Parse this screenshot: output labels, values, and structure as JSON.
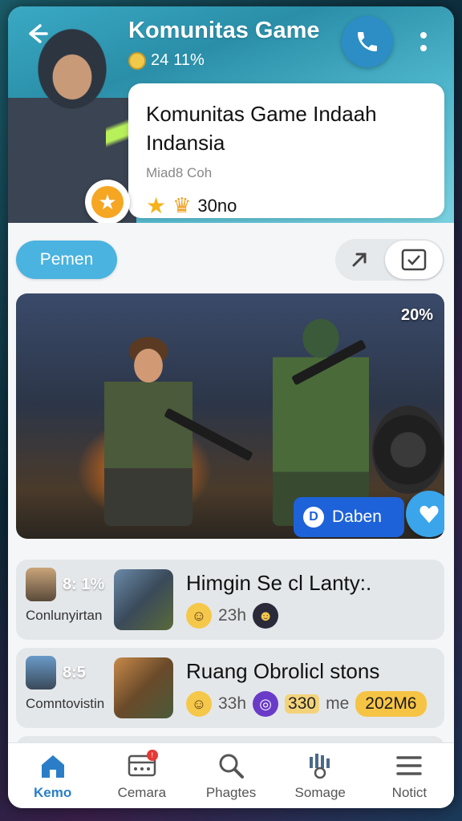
{
  "header": {
    "title": "Komunitas Game",
    "meta_count": "24",
    "meta_percent": "11%"
  },
  "info_card": {
    "name": "Komunitas Game Indaah Indansia",
    "subtitle": "Miad8 Coh",
    "rating": "30no"
  },
  "actions": {
    "pill_label": "Pemen"
  },
  "media": {
    "percent": "20%",
    "chip_label": "Daben"
  },
  "list": [
    {
      "pct": "8: 1%",
      "label": "Conlunyirtan",
      "title": "Himgin Se cl Lanty:.",
      "time": "23h"
    },
    {
      "pct": "8:5",
      "label": "Comntovistin",
      "title": "Ruang Obrolicl stons",
      "time": "33h",
      "count": "330",
      "count_suffix": "me",
      "tag": "202M6"
    }
  ],
  "nav": [
    {
      "label": "Kemo",
      "icon": "home-icon"
    },
    {
      "label": "Cemara",
      "icon": "inbox-icon"
    },
    {
      "label": "Phagtes",
      "icon": "search-icon"
    },
    {
      "label": "Somage",
      "icon": "stats-icon"
    },
    {
      "label": "Notict",
      "icon": "menu-icon"
    }
  ],
  "colors": {
    "accent": "#2a7ec8",
    "pill": "#4ab3e0",
    "chip": "#1d62d8",
    "tag": "#f6c445"
  }
}
